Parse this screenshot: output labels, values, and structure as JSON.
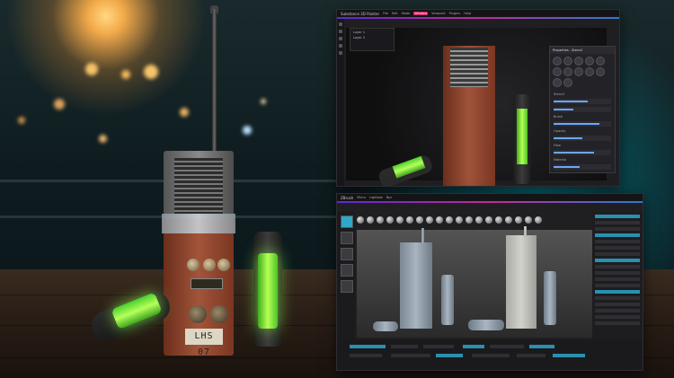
{
  "scene": {
    "radio_tag_text": "LHS 07",
    "colors": {
      "lamp": "#f2a94a",
      "glow": "#9cff4a",
      "teal_light": "#00aabe",
      "radio_paint": "#a2553a"
    }
  },
  "painter_window": {
    "app_name": "Substance 3D Painter",
    "menu": [
      "File",
      "Edit",
      "Mode",
      "Window",
      "Viewport",
      "Plugins",
      "Help"
    ],
    "active_menu_index": 3,
    "scene_items": [
      "Layer 1",
      "Layer 2"
    ],
    "panel_title": "Properties - Stencil",
    "panel_sections": [
      "Stencil",
      "Brush",
      "Opacity",
      "Flow",
      "Material"
    ],
    "accent_color": "#d02060"
  },
  "zbrush_window": {
    "app_name": "ZBrush",
    "menu": [
      "Menu",
      "Lightbox",
      "Bpr"
    ],
    "variant_left": "gray",
    "variant_right": "white"
  }
}
